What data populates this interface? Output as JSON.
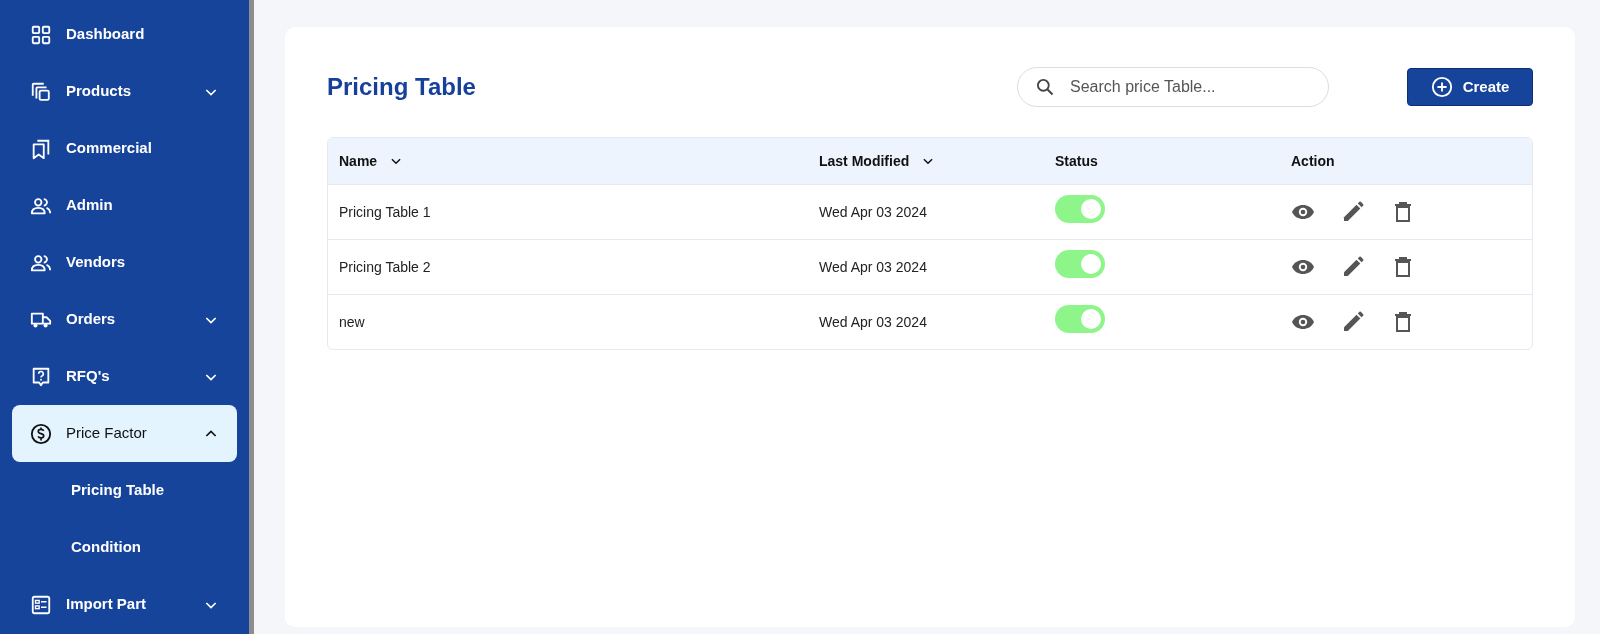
{
  "sidebar": {
    "items": [
      {
        "label": "Dashboard",
        "selected": false
      },
      {
        "label": "Products",
        "selected": false,
        "expanded": false
      },
      {
        "label": "Commercial",
        "selected": false
      },
      {
        "label": "Admin",
        "selected": false
      },
      {
        "label": "Vendors",
        "selected": false
      },
      {
        "label": "Orders",
        "selected": false,
        "expanded": false
      },
      {
        "label": "RFQ's",
        "selected": false,
        "expanded": false
      },
      {
        "label": "Price Factor",
        "selected": true,
        "expanded": true,
        "children": [
          {
            "label": "Pricing Table"
          },
          {
            "label": "Condition"
          }
        ]
      },
      {
        "label": "Import Part",
        "selected": false,
        "expanded": false
      }
    ]
  },
  "page": {
    "title": "Pricing Table",
    "search": {
      "placeholder": "Search price Table..."
    },
    "create_button": "Create"
  },
  "table": {
    "columns": [
      {
        "label": "Name",
        "sortable": true
      },
      {
        "label": "Last Modified",
        "sortable": true
      },
      {
        "label": "Status",
        "sortable": false
      },
      {
        "label": "Action",
        "sortable": false
      }
    ],
    "rows": [
      {
        "name": "Pricing Table 1",
        "modified": "Wed Apr 03 2024",
        "on": true
      },
      {
        "name": "Pricing Table 2",
        "modified": "Wed Apr 03 2024",
        "on": true
      },
      {
        "name": "new",
        "modified": "Wed Apr 03 2024",
        "on": true
      }
    ]
  }
}
